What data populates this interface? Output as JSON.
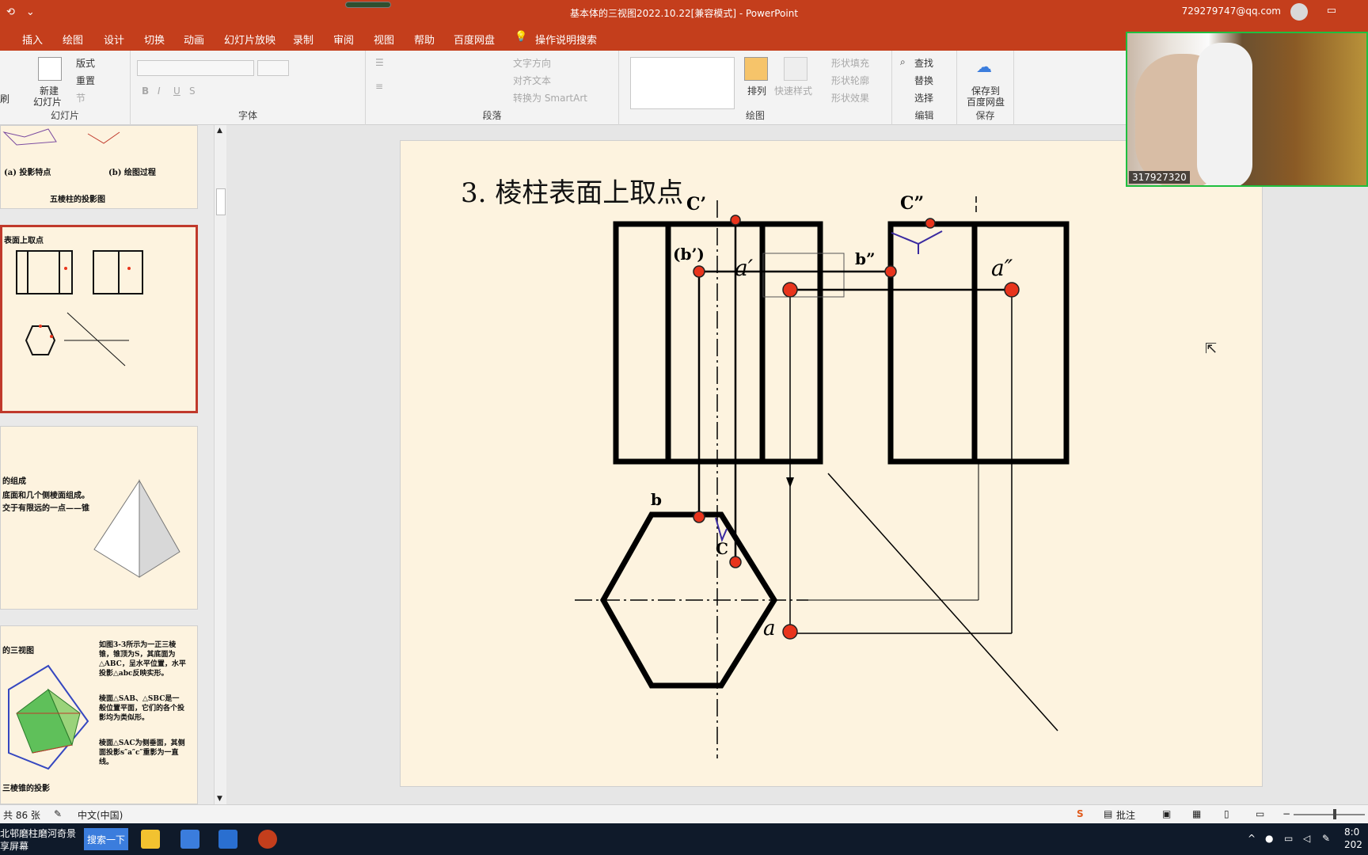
{
  "window": {
    "title": "基本体的三视图2022.10.22[兼容模式]  -  PowerPoint",
    "account": "729279747@qq.com"
  },
  "tabs": [
    "插入",
    "绘图",
    "设计",
    "切换",
    "动画",
    "幻灯片放映",
    "录制",
    "审阅",
    "视图",
    "帮助",
    "百度网盘",
    "操作说明搜索"
  ],
  "ribbon": {
    "slides_group": {
      "label": "幻灯片",
      "new_slide": "新建",
      "new_slide2": "幻灯片",
      "layout": "版式",
      "reset": "重置",
      "section": "节",
      "brush": "刷"
    },
    "font_group": {
      "label": "字体"
    },
    "paragraph_group": {
      "label": "段落",
      "text_direction": "文字方向",
      "align_text": "对齐文本",
      "smartart": "转换为 SmartArt"
    },
    "drawing_group": {
      "label": "绘图",
      "arrange": "排列",
      "quick_styles": "快速样式",
      "fill": "形状填充",
      "outline": "形状轮廓",
      "effects": "形状效果"
    },
    "editing_group": {
      "label": "编辑",
      "find": "查找",
      "replace": "替换",
      "select": "选择"
    },
    "save_group": {
      "label": "保存",
      "save_line1": "保存到",
      "save_line2": "百度网盘"
    }
  },
  "thumbnails": {
    "t1": {
      "caption_a": "(a)  投影特点",
      "caption_b": "(b)  绘图过程",
      "title": "五棱柱的投影图"
    },
    "t2": {
      "title": "表面上取点"
    },
    "t3": {
      "line1": "的组成",
      "line2": "底面和几个侧棱面组成。",
      "line3": "交于有限远的一点——锥"
    },
    "t4": {
      "title": "的三视图",
      "bottom": "三棱锥的投影",
      "p1": "如图3-3所示为一正三棱锥，锥顶为S，其底面为△ABC，呈水平位置，水平投影△abc反映实形。",
      "p2": "棱面△SAB、△SBC是一般位置平面，它们的各个投影均为类似形。",
      "p3": "棱面△SAC为侧垂面，其侧面投影s″a″c″重影为一直线。"
    }
  },
  "slide": {
    "title": "3.  棱柱表面上取点",
    "labels": {
      "c_front": "C’",
      "b_front": "(b’)",
      "a_front": "a′",
      "c_side": "C”",
      "b_side": "b”",
      "a_side": "a″",
      "b_top": "b",
      "c_top": "C",
      "a_top": "a"
    },
    "point_color": "#e8341c"
  },
  "webcam": {
    "id": "317927320"
  },
  "statusbar": {
    "slide_count": "共 86 张",
    "language": "中文(中国)",
    "comments": "批注"
  },
  "taskbar": {
    "news": "北邨磨柱磨河奇景",
    "news2": "享屏幕",
    "search": "搜索一下",
    "time": "8:0",
    "date": "202"
  }
}
